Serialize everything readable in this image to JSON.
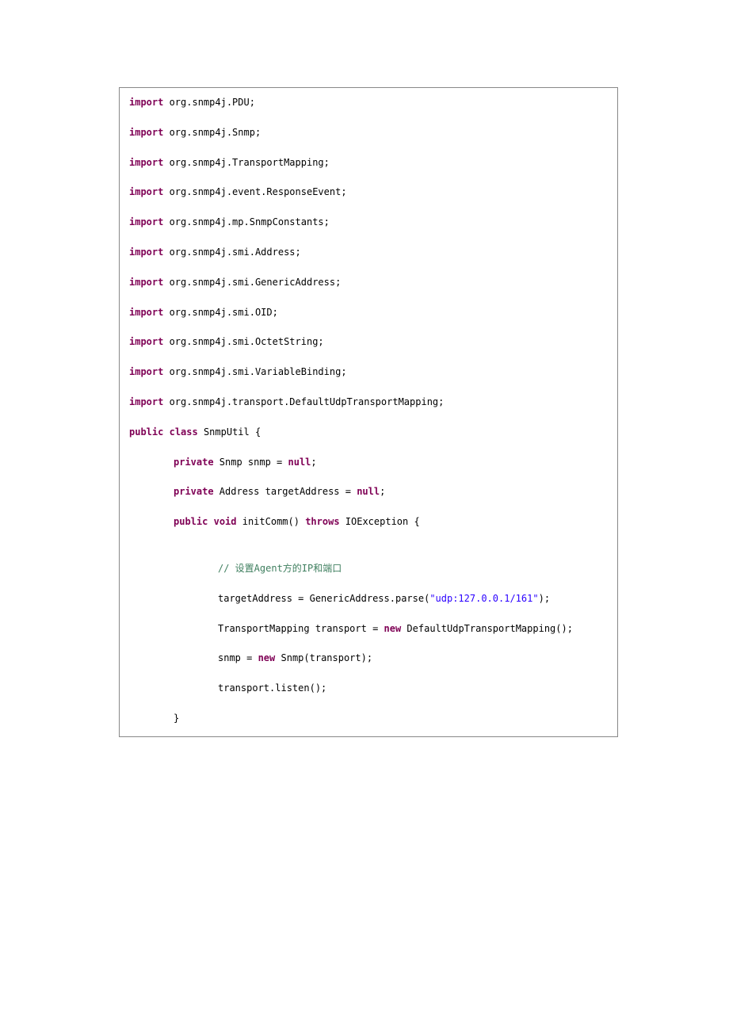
{
  "code": {
    "imports": [
      {
        "kw": "import",
        "pkg": " org.snmp4j.PDU;"
      },
      {
        "kw": "import",
        "pkg": " org.snmp4j.Snmp;"
      },
      {
        "kw": "import",
        "pkg": " org.snmp4j.TransportMapping;"
      },
      {
        "kw": "import",
        "pkg": " org.snmp4j.event.ResponseEvent;"
      },
      {
        "kw": "import",
        "pkg": " org.snmp4j.mp.SnmpConstants;"
      },
      {
        "kw": "import",
        "pkg": " org.snmp4j.smi.Address;"
      },
      {
        "kw": "import",
        "pkg": " org.snmp4j.smi.GenericAddress;"
      },
      {
        "kw": "import",
        "pkg": " org.snmp4j.smi.OID;"
      },
      {
        "kw": "import",
        "pkg": " org.snmp4j.smi.OctetString;"
      },
      {
        "kw": "import",
        "pkg": " org.snmp4j.smi.VariableBinding;"
      },
      {
        "kw": "import",
        "pkg": " org.snmp4j.transport.DefaultUdpTransportMapping;"
      }
    ],
    "classDecl": {
      "kw1": "public",
      "kw2": "class",
      "name": " SnmpUtil {"
    },
    "field1": {
      "kw1": "private",
      "type": " Snmp snmp = ",
      "kw2": "null",
      "end": ";"
    },
    "field2": {
      "kw1": "private",
      "type": " Address targetAddress = ",
      "kw2": "null",
      "end": ";"
    },
    "method": {
      "kw1": "public",
      "kw2": "void",
      "name": " initComm() ",
      "kw3": "throws",
      "rest": " IOException {"
    },
    "comment": "// 设置Agent方的IP和端口",
    "line1a": "targetAddress = GenericAddress.parse(",
    "line1str": "\"udp:127.0.0.1/161\"",
    "line1b": ");",
    "line2a": "TransportMapping transport = ",
    "line2kw": "new",
    "line2b": " DefaultUdpTransportMapping();",
    "line3a": "snmp = ",
    "line3kw": "new",
    "line3b": " Snmp(transport);",
    "line4": "transport.listen();",
    "closeBrace": "}"
  }
}
